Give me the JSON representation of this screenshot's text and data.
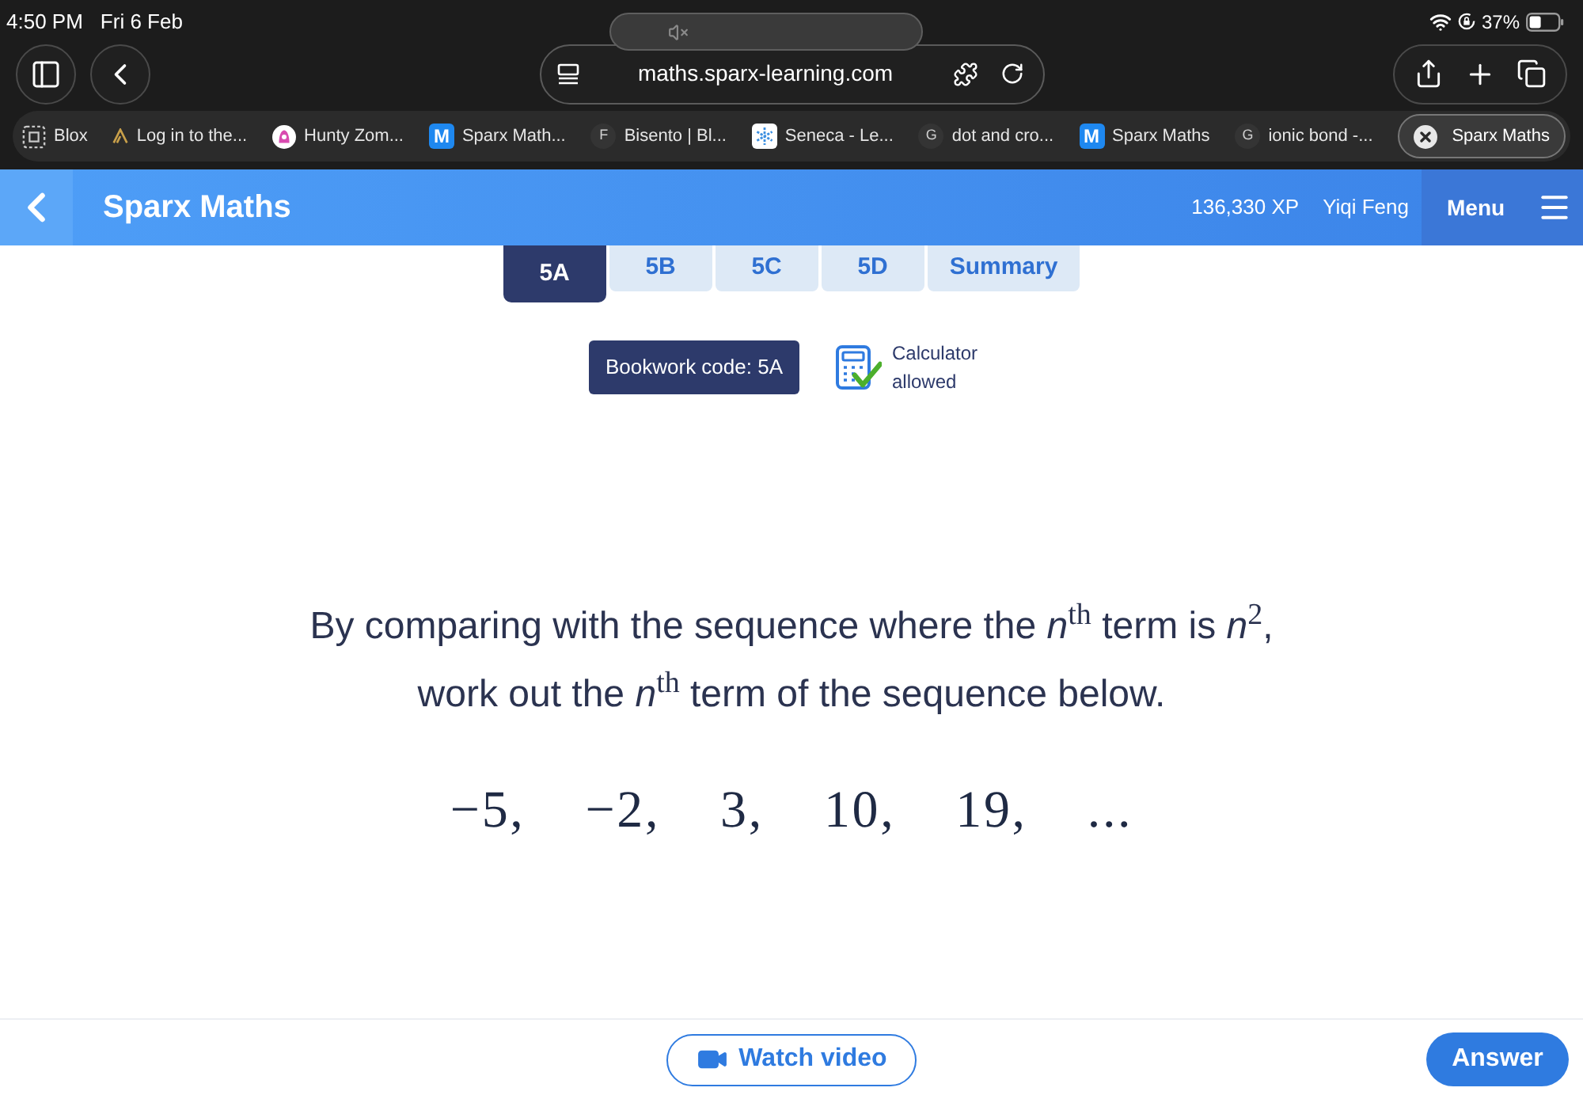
{
  "status_bar": {
    "time": "4:50 PM",
    "date": "Fri 6 Feb",
    "battery": "37%"
  },
  "browser": {
    "url": "maths.sparx-learning.com"
  },
  "browser_tabs": [
    {
      "title": "Blox",
      "kind": "dotted-square",
      "selected": false
    },
    {
      "title": "Log in to the...",
      "kind": "lambda",
      "selected": false
    },
    {
      "title": "Hunty Zom...",
      "kind": "round-logo",
      "selected": false
    },
    {
      "title": "Sparx Math...",
      "kind": "letter-tile",
      "icon_text": "M",
      "selected": false
    },
    {
      "title": "Bisento | Bl...",
      "kind": "letter",
      "icon_text": "F",
      "selected": false
    },
    {
      "title": "Seneca - Le...",
      "kind": "snowflake-tile",
      "selected": false
    },
    {
      "title": "dot and cro...",
      "kind": "letter",
      "icon_text": "G",
      "selected": false
    },
    {
      "title": "Sparx Maths",
      "kind": "letter-tile",
      "icon_text": "M",
      "selected": false
    },
    {
      "title": "ionic bond -...",
      "kind": "letter",
      "icon_text": "G",
      "selected": false
    },
    {
      "title": "Sparx Maths",
      "kind": "close",
      "selected": true
    }
  ],
  "header": {
    "title": "Sparx Maths",
    "xp": "136,330 XP",
    "user": "Yiqi Feng",
    "menu": "Menu"
  },
  "tabs": [
    {
      "label": "5A",
      "selected": true
    },
    {
      "label": "5B",
      "selected": false
    },
    {
      "label": "5C",
      "selected": false
    },
    {
      "label": "5D",
      "selected": false
    },
    {
      "label": "Summary",
      "selected": false
    }
  ],
  "bookwork": {
    "label": "Bookwork code: 5A"
  },
  "calculator": {
    "label": "Calculator allowed",
    "allowed": true
  },
  "question": {
    "text": "By comparing with the sequence where the *n*$^{th}$ term is *n*$^{2}$,\nwork out the *n*$^{th}$ term of the sequence below.",
    "sequence": [
      "−5,",
      "−2,",
      "3,",
      "10,",
      "19,",
      "..."
    ]
  },
  "actions": {
    "watch_video": "Watch video",
    "answer": "Answer"
  }
}
